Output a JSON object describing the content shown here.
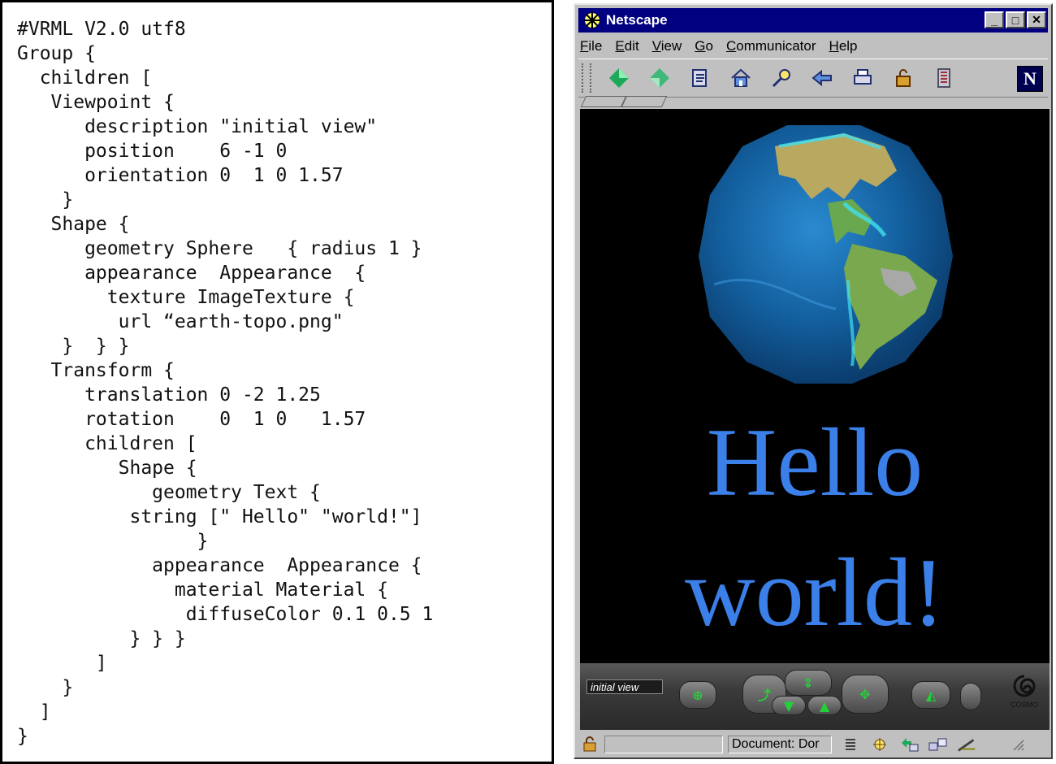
{
  "code_listing": {
    "lines": [
      "#VRML V2.0 utf8",
      "Group {",
      "  children [",
      "   Viewpoint {",
      "      description \"initial view\"",
      "      position    6 -1 0",
      "      orientation 0  1 0 1.57",
      "    }",
      "   Shape {",
      "      geometry Sphere   { radius 1 }",
      "      appearance  Appearance  {",
      "        texture ImageTexture {",
      "         url “earth-topo.png\"",
      "    }  } }",
      "   Transform {",
      "      translation 0 -2 1.25",
      "      rotation    0  1 0   1.57",
      "      children [",
      "         Shape {",
      "            geometry Text {",
      "          string [\" Hello\" \"world!\"]",
      "                }",
      "            appearance  Appearance {",
      "              material Material {",
      "               diffuseColor 0.1 0.5 1",
      "          } } }",
      "       ]",
      "    }",
      "  ]",
      "}"
    ]
  },
  "browser": {
    "title": "Netscape",
    "menu": [
      "File",
      "Edit",
      "View",
      "Go",
      "Communicator",
      "Help"
    ],
    "toolbar_icons": [
      "back-arrow-icon",
      "forward-arrow-icon",
      "reload-icon",
      "home-icon",
      "search-icon",
      "guide-icon",
      "print-icon",
      "security-lock-icon",
      "stop-icon"
    ],
    "logo_letter": "N",
    "scene": {
      "line1": "Hello",
      "line2": "world!",
      "text_color": "#3b7fe8"
    },
    "cosmo": {
      "viewpoint_label": "initial view",
      "brand": "COSMO"
    },
    "status": {
      "text": "Document: Dor"
    }
  },
  "colors": {
    "title_bar": "#000080",
    "chrome": "#c0c0c0",
    "viewport_bg": "#000000",
    "scene_text": "#3b7fe8"
  }
}
